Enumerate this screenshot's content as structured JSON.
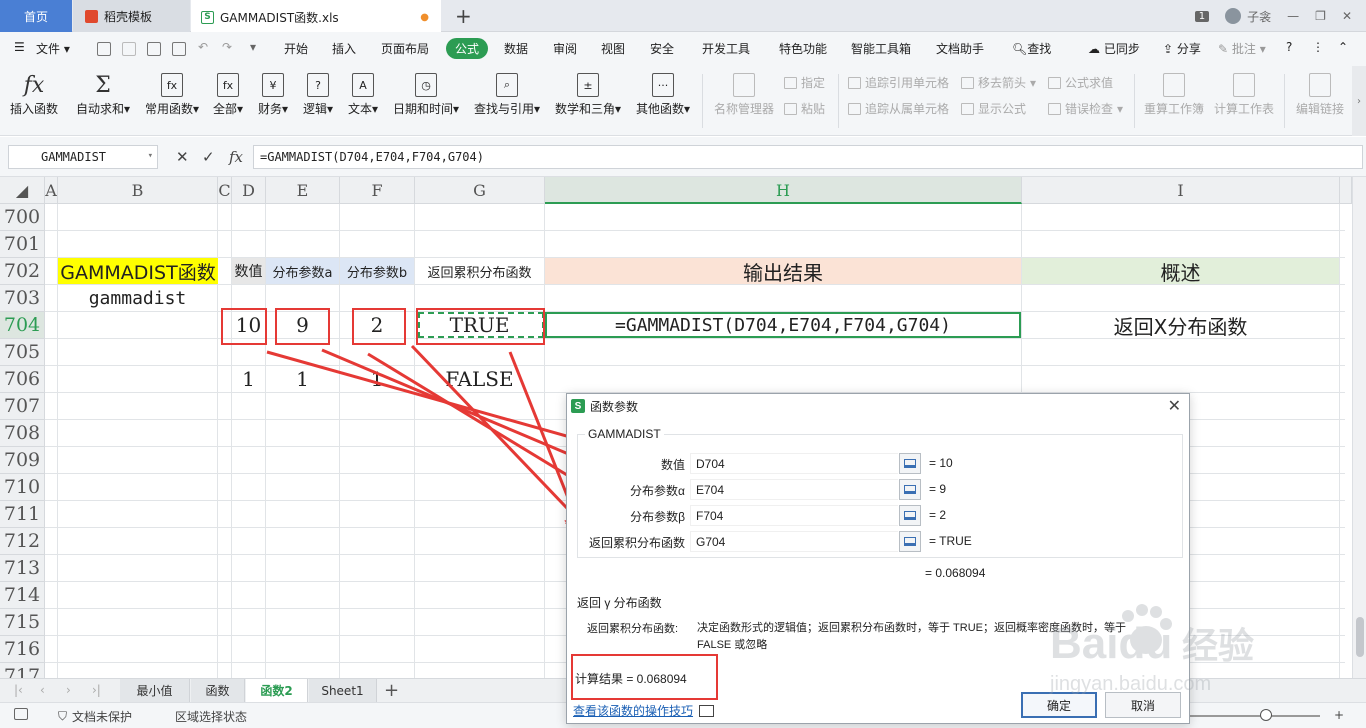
{
  "window": {
    "tabs": [
      {
        "label": "首页"
      },
      {
        "label": "稻壳模板"
      },
      {
        "label": "GAMMADIST函数.xls"
      }
    ],
    "window_count": "1",
    "user_name": "子衾"
  },
  "menu": {
    "file": "文件",
    "items": [
      "开始",
      "插入",
      "页面布局",
      "公式",
      "数据",
      "审阅",
      "视图",
      "安全",
      "开发工具",
      "特色功能",
      "智能工具箱",
      "文档助手"
    ],
    "active": "公式",
    "search": "查找",
    "synced": "已同步",
    "share": "分享",
    "comment": "批注"
  },
  "ribbon": {
    "insert_function": "插入函数",
    "autosum": "自动求和",
    "common": "常用函数",
    "all": "全部",
    "finance": "财务",
    "logic": "逻辑",
    "text": "文本",
    "datetime": "日期和时间",
    "lookup": "查找与引用",
    "math": "数学和三角",
    "other": "其他函数",
    "name_manager": "名称管理器",
    "specify": "指定",
    "paste": "粘贴",
    "trace_precedents": "追踪引用单元格",
    "trace_dependents": "追踪从属单元格",
    "remove_arrows": "移去箭头",
    "show_formulas": "显示公式",
    "evaluate": "公式求值",
    "error_check": "错误检查",
    "recalc_book": "重算工作簿",
    "calc_sheet": "计算工作表",
    "edit_links": "编辑链接"
  },
  "formula_bar": {
    "name_box": "GAMMADIST",
    "formula": "=GAMMADIST(D704,E704,F704,G704)"
  },
  "grid": {
    "columns": [
      "A",
      "B",
      "C",
      "D",
      "E",
      "F",
      "G",
      "H",
      "I"
    ],
    "selected_column": "H",
    "rows": [
      "700",
      "701",
      "702",
      "703",
      "704",
      "705",
      "706",
      "707",
      "708",
      "709",
      "710",
      "711",
      "712",
      "713",
      "714",
      "715",
      "716",
      "717"
    ],
    "selected_row": "704",
    "header_row": {
      "b": "GAMMADIST函数",
      "d": "数值",
      "e": "分布参数a",
      "f": "分布参数b",
      "g": "返回累积分布函数",
      "h": "输出结果",
      "i": "概述"
    },
    "b703": "gammadist",
    "row704": {
      "d": "10",
      "e": "9",
      "f": "2",
      "g": "TRUE",
      "h": "=GAMMADIST(D704,E704,F704,G704)",
      "i": "返回X分布函数"
    },
    "row706": {
      "d": "1",
      "e": "1",
      "f": "1",
      "g": "FALSE"
    }
  },
  "sheets": {
    "tabs": [
      "最小值",
      "函数",
      "函数2",
      "Sheet1"
    ],
    "active": "函数2"
  },
  "status": {
    "protect": "文档未保护",
    "select_mode": "区域选择状态"
  },
  "dialog": {
    "title": "函数参数",
    "function_name": "GAMMADIST",
    "params": [
      {
        "label": "数值",
        "input": "D704",
        "value": "= 10"
      },
      {
        "label": "分布参数α",
        "input": "E704",
        "value": "= 9"
      },
      {
        "label": "分布参数β",
        "input": "F704",
        "value": "= 2"
      },
      {
        "label": "返回累积分布函数",
        "input": "G704",
        "value": "= TRUE"
      }
    ],
    "result_top": "= 0.068094",
    "description": "返回 γ 分布函数",
    "arg_label": "返回累积分布函数:",
    "arg_description": "决定函数形式的逻辑值；返回累积分布函数时，等于 TRUE；返回概率密度函数时，等于 FALSE 或忽略",
    "calc_result": "计算结果 = 0.068094",
    "help_link": "查看该函数的操作技巧",
    "ok": "确定",
    "cancel": "取消"
  },
  "watermark": {
    "brand": "Baidu",
    "sub": "经验",
    "url": "jingyan.baidu.com"
  },
  "colors": {
    "accent": "#2c9c53",
    "annotation": "#e53935",
    "header_yellow": "#ffff00",
    "header_blue": "#dce6f5",
    "header_orange": "#fbe3d6",
    "header_green": "#e2efda"
  }
}
